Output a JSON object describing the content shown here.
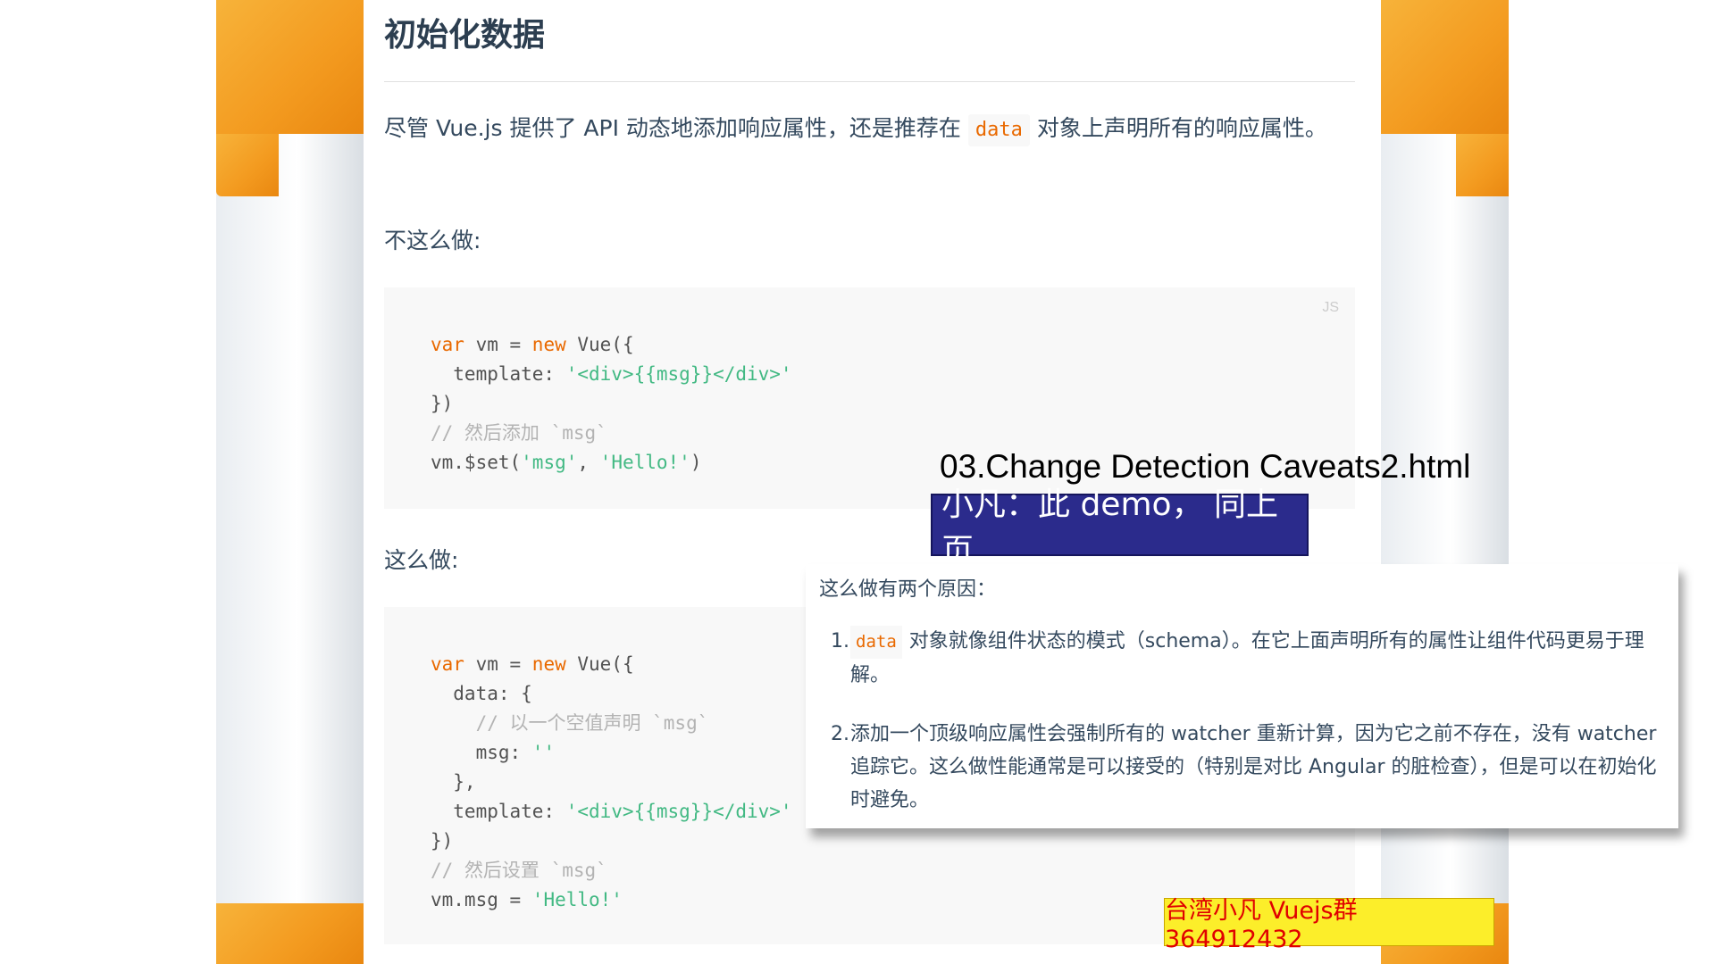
{
  "title": "初始化数据",
  "intro": {
    "before": "尽管 Vue.js 提供了 API 动态地添加响应属性，还是推荐在",
    "code": "data",
    "after": "对象上声明所有的响应属性。"
  },
  "dont_label": "不这么做:",
  "do_label": "这么做:",
  "lang_tag": "JS",
  "code1": {
    "l1_kw1": "var",
    "l1_mid": " vm = ",
    "l1_kw2": "new",
    "l1_end": " Vue({",
    "l2_key": "  template: ",
    "l2_str": "'<div>{{msg}}</div>'",
    "l3": "})",
    "l4_comment": "// 然后添加 `msg`",
    "l5_a": "vm.$set(",
    "l5_s1": "'msg'",
    "l5_b": ", ",
    "l5_s2": "'Hello!'",
    "l5_c": ")"
  },
  "code2": {
    "l1_kw1": "var",
    "l1_mid": " vm = ",
    "l1_kw2": "new",
    "l1_end": " Vue({",
    "l2": "  data: {",
    "l3_comment": "    // 以一个空值声明 `msg`",
    "l4_key": "    msg: ",
    "l4_str": "''",
    "l5": "  },",
    "l6_key": "  template: ",
    "l6_str": "'<div>{{msg}}</div>'",
    "l7": "})",
    "l8_comment": "// 然后设置 `msg`",
    "l9_a": "vm.msg = ",
    "l9_str": "'Hello!'"
  },
  "annotation": {
    "file": "03.Change Detection Caveats2.html",
    "caption": "小凡：此 demo， 同上页"
  },
  "note": {
    "head": "这么做有两个原因：",
    "item1_num": "1.",
    "item1_code": "data",
    "item1_text": "对象就像组件状态的模式（schema）。在它上面声明所有的属性让组件代码更易于理解。",
    "item2_num": "2.",
    "item2_text": "添加一个顶级响应属性会强制所有的 watcher 重新计算，因为它之前不存在，没有 watcher 追踪它。这么做性能通常是可以接受的（特别是对比 Angular 的脏检查），但是可以在初始化时避免。"
  },
  "watermark": "台湾小凡 Vuejs群 364912432",
  "colors": {
    "accent_orange": "#f39a1f",
    "code_keyword": "#e96900",
    "code_string": "#42b983",
    "caption_bg": "#2b2b8c",
    "watermark_bg": "#fcee2a",
    "watermark_text": "#e00000"
  }
}
